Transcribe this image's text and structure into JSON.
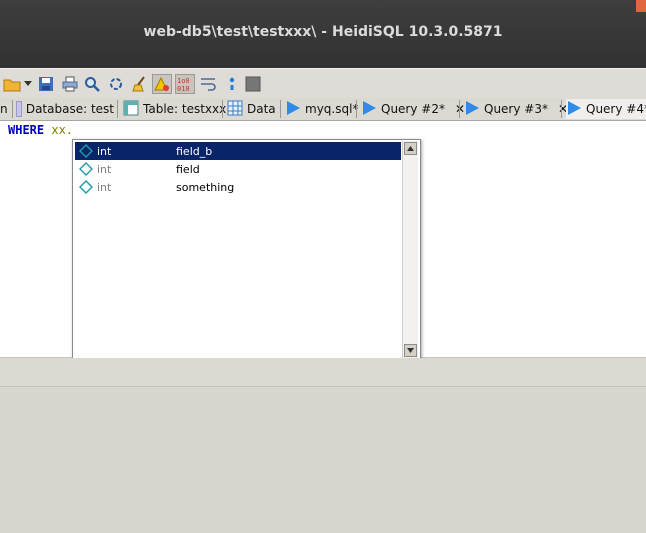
{
  "window": {
    "title": "web-db5\\test\\testxxx\\ - HeidiSQL 10.3.0.5871"
  },
  "toolbar": {
    "icons": [
      "folder-icon",
      "dropdown-arrow-icon",
      "save-icon",
      "print-icon",
      "search-icon",
      "search-replace-icon",
      "clear-icon",
      "warning-icon",
      "binary-icon",
      "wrap-icon",
      "semicolon-icon",
      "stop-icon"
    ]
  },
  "tabs": [
    {
      "label": "n"
    },
    {
      "label": "Database: test"
    },
    {
      "label": "Table: testxxx"
    },
    {
      "label": "Data"
    },
    {
      "label": "myq.sql*"
    },
    {
      "label": "Query #2*"
    },
    {
      "label": "Query #3*"
    },
    {
      "label": "Query #4*"
    }
  ],
  "editor": {
    "keyword": "WHERE",
    "text": " xx."
  },
  "autocomplete": {
    "items": [
      {
        "type": "int",
        "name": "field_b",
        "selected": true
      },
      {
        "type": "int",
        "name": "field",
        "selected": false
      },
      {
        "type": "int",
        "name": "something",
        "selected": false
      }
    ]
  },
  "colors": {
    "selection": "#0a246a",
    "keyword": "#0000c8",
    "query_icon": "#2e8be6"
  }
}
